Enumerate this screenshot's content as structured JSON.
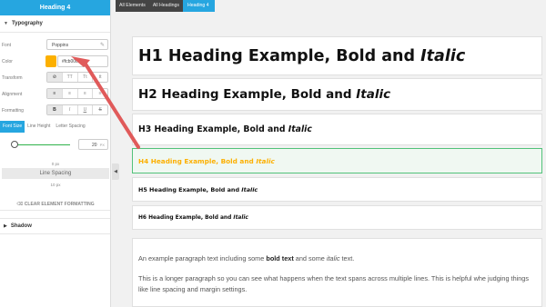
{
  "panel": {
    "title": "Heading 4",
    "typography_label": "Typography",
    "font": {
      "label": "Font",
      "value": "Poppins"
    },
    "color": {
      "label": "Color",
      "value": "#fcb000",
      "swatch": "#fcb000"
    },
    "transform": {
      "label": "Transform",
      "options": [
        "⊘",
        "TT",
        "Tt",
        "tt"
      ]
    },
    "alignment": {
      "label": "Alignment",
      "options": [
        "≡",
        "≡",
        "≡",
        "≡"
      ]
    },
    "formatting": {
      "label": "Formatting",
      "options": [
        "B",
        "I",
        "U",
        "S"
      ]
    },
    "tabs": [
      "Font Size",
      "Line Height",
      "Letter Spacing"
    ],
    "font_size": {
      "value": "20",
      "unit": "PX",
      "slider_fraction": 0.05
    },
    "line_spacing": {
      "top": "0 px",
      "label": "Line Spacing",
      "bottom": "10 px"
    },
    "clear_label": "CLEAR ELEMENT FORMATTING",
    "shadow_label": "Shadow"
  },
  "breadcrumb": [
    "All Elements",
    "All Headings",
    "Heading 4"
  ],
  "headings": [
    {
      "text": "H1 Heading Example, Bold and ",
      "italic": "Italic"
    },
    {
      "text": "H2 Heading Example, Bold and ",
      "italic": "Italic"
    },
    {
      "text": "H3 Heading Example, Bold and ",
      "italic": "Italic"
    },
    {
      "text": "H4 Heading Example, Bold and ",
      "italic": "Italic"
    },
    {
      "text": "H5 Heading Example, Bold and ",
      "italic": "Italic"
    },
    {
      "text": "H6 Heading Example, Bold and ",
      "italic": "Italic"
    }
  ],
  "paragraph": {
    "p1_a": "An example paragraph text including some ",
    "p1_bold": "bold text",
    "p1_b": " and some ",
    "p1_italic": "italic",
    "p1_c": " text.",
    "p2": "This is a longer paragraph so you can see what happens when the text spans across multiple lines. This is helpful whe judging things like line spacing and margin settings."
  },
  "colors": {
    "accent": "#26a6e0",
    "highlight": "#fcb000",
    "arrow": "#e05a5a"
  }
}
